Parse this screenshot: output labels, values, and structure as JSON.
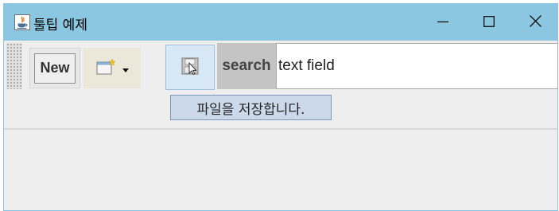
{
  "window": {
    "title": "툴팁 예제",
    "icon": "java-icon",
    "controls": [
      "minimize-icon",
      "maximize-icon",
      "close-icon"
    ]
  },
  "toolbar": {
    "new_label": "New",
    "open_icon": "open-folder-icon",
    "save_icon": "save-icon",
    "search_label": "search",
    "search_value": "text field"
  },
  "tooltip": {
    "text": "파일을 저장합니다."
  },
  "colors": {
    "titlebar": "#8cc7e1",
    "tooltip_bg": "#cbd9ea",
    "tooltip_border": "#7e96bd",
    "content_bg": "#eeeeee"
  }
}
